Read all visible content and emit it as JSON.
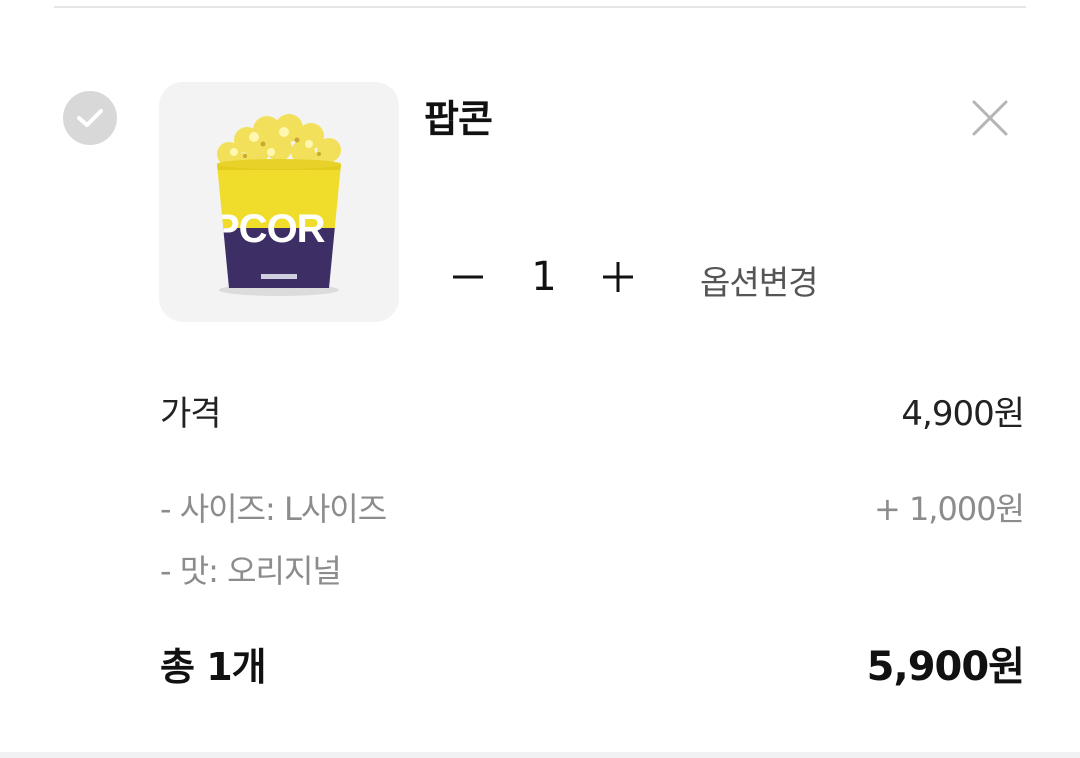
{
  "cart_item": {
    "product_name": "팝콘",
    "image_icon": "popcorn-bucket-icon",
    "bucket_print": "PCOR",
    "quantity": "1",
    "option_change_label": "옵션변경"
  },
  "pricing": {
    "price_label": "가격",
    "price_value": "4,900원",
    "options": [
      {
        "label": "- 사이즈: L사이즈",
        "value": "+ 1,000원"
      },
      {
        "label": "- 맛: 오리지널",
        "value": ""
      }
    ],
    "total_label": "총 1개",
    "total_value": "5,900원"
  },
  "colors": {
    "check_bg": "#d8d8d8",
    "muted_text": "#8c8c8c",
    "bucket_yellow": "#f0dc2a",
    "bucket_purple": "#3d2e66"
  }
}
